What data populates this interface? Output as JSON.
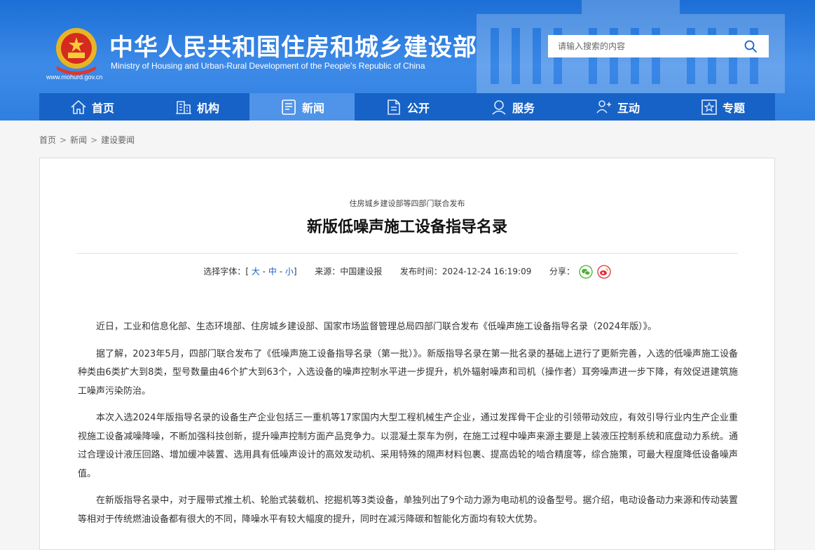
{
  "header": {
    "title_cn": "中华人民共和国住房和城乡建设部",
    "title_en": "Ministry of Housing and Urban-Rural Development of the People's Republic of China",
    "site_url": "www.mohurd.gov.cn",
    "colors": {
      "primary": "#2f7fe0",
      "nav": "#1762c6",
      "nav_active": "#4f94e8"
    }
  },
  "search": {
    "placeholder": "请输入搜索的内容",
    "value": "",
    "icon": "search-icon"
  },
  "nav": [
    {
      "label": "首页",
      "icon": "home-icon"
    },
    {
      "label": "机构",
      "icon": "building-icon"
    },
    {
      "label": "新闻",
      "icon": "news-icon",
      "active": true
    },
    {
      "label": "公开",
      "icon": "document-icon"
    },
    {
      "label": "服务",
      "icon": "service-icon"
    },
    {
      "label": "互动",
      "icon": "interaction-icon"
    },
    {
      "label": "专题",
      "icon": "star-icon"
    }
  ],
  "breadcrumb": {
    "items": [
      "首页",
      "新闻",
      "建设要闻"
    ],
    "separator": ">"
  },
  "article": {
    "subtitle": "住房城乡建设部等四部门联合发布",
    "title": "新版低噪声施工设备指导名录",
    "meta": {
      "font_label": "选择字体：",
      "bracket_open": "[",
      "font_large": "大",
      "font_medium": "中",
      "font_small": "小",
      "dash": "-",
      "bracket_close": "]",
      "source_label": "来源：",
      "source": "中国建设报",
      "time_label": "发布时间：",
      "time": "2024-12-24 16:19:09",
      "share_label": "分享：",
      "share_icons": [
        "wechat-icon",
        "weibo-icon"
      ]
    },
    "paragraphs": [
      "近日，工业和信息化部、生态环境部、住房城乡建设部、国家市场监督管理总局四部门联合发布《低噪声施工设备指导名录（2024年版）》。",
      "据了解，2023年5月，四部门联合发布了《低噪声施工设备指导名录（第一批）》。新版指导名录在第一批名录的基础上进行了更新完善，入选的低噪声施工设备种类由6类扩大到8类，型号数量由46个扩大到63个，入选设备的噪声控制水平进一步提升，机外辐射噪声和司机（操作者）耳旁噪声进一步下降，有效促进建筑施工噪声污染防治。",
      "本次入选2024年版指导名录的设备生产企业包括三一重机等17家国内大型工程机械生产企业，通过发挥骨干企业的引领带动效应，有效引导行业内生产企业重视施工设备减噪降噪，不断加强科技创新，提升噪声控制方面产品竞争力。以混凝土泵车为例，在施工过程中噪声来源主要是上装液压控制系统和底盘动力系统。通过合理设计液压回路、增加缓冲装置、选用具有低噪声设计的高效发动机、采用特殊的隔声材料包裹、提高齿轮的啮合精度等，综合施策，可最大程度降低设备噪声值。",
      "在新版指导名录中，对于履带式推土机、轮胎式装载机、挖掘机等3类设备，单独列出了9个动力源为电动机的设备型号。据介绍，电动设备动力来源和传动装置等相对于传统燃油设备都有很大的不同，降噪水平有较大幅度的提升，同时在减污降碳和智能化方面均有较大优势。"
    ]
  }
}
